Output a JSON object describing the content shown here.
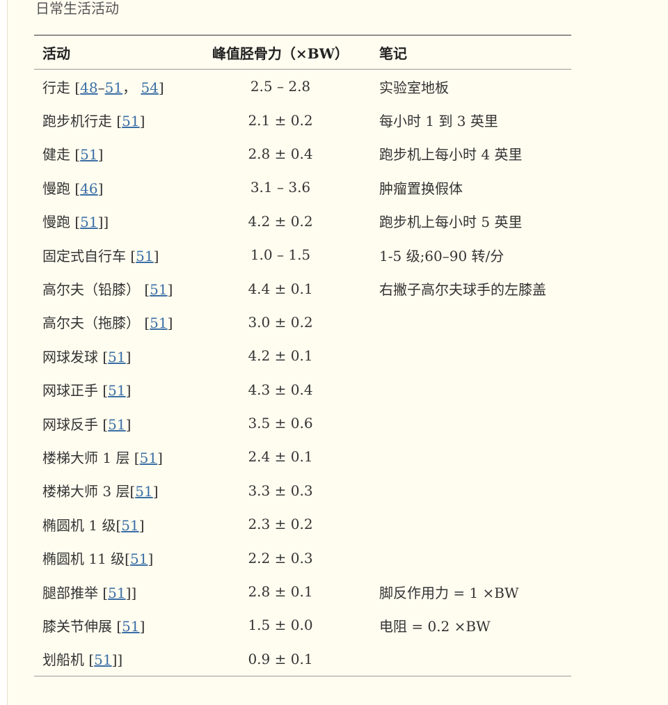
{
  "caption": "日常生活活动",
  "headers": {
    "activity": "活动",
    "force": "峰值胫骨力（×BW）",
    "notes": "笔记"
  },
  "rows": [
    {
      "activity": "行走 ",
      "refs": [
        {
          "pre": "[",
          "ref": "48",
          "post": ""
        },
        {
          "pre": "–",
          "ref": "51",
          "post": "，"
        },
        {
          "pre": " ",
          "ref": "54",
          "post": "]"
        }
      ],
      "force": "2.5 – 2.8",
      "note": "实验室地板"
    },
    {
      "activity": "跑步机行走 ",
      "refs": [
        {
          "pre": "[",
          "ref": "51",
          "post": "]"
        }
      ],
      "force": "2.1 ± 0.2",
      "note": "每小时 1 到 3 英里"
    },
    {
      "activity": "健走 ",
      "refs": [
        {
          "pre": "[",
          "ref": "51",
          "post": "]"
        }
      ],
      "force": "2.8 ± 0.4",
      "note": "跑步机上每小时 4 英里"
    },
    {
      "activity": "慢跑 ",
      "refs": [
        {
          "pre": "[",
          "ref": "46",
          "post": "]"
        }
      ],
      "force": "3.1 – 3.6",
      "note": "肿瘤置换假体"
    },
    {
      "activity": "慢跑 ",
      "refs": [
        {
          "pre": "[",
          "ref": "51",
          "post": "]]"
        }
      ],
      "force": "4.2 ± 0.2",
      "note": "跑步机上每小时 5 英里"
    },
    {
      "activity": "固定式自行车 ",
      "refs": [
        {
          "pre": "[",
          "ref": "51",
          "post": "]"
        }
      ],
      "force": "1.0 – 1.5",
      "note": "1-5 级;60–90 转/分"
    },
    {
      "activity": "高尔夫（铅膝） ",
      "refs": [
        {
          "pre": "[",
          "ref": "51",
          "post": "]"
        }
      ],
      "force": "4.4 ± 0.1",
      "note": "右撇子高尔夫球手的左膝盖"
    },
    {
      "activity": "高尔夫（拖膝） ",
      "refs": [
        {
          "pre": "[",
          "ref": "51",
          "post": "]"
        }
      ],
      "force": "3.0 ± 0.2",
      "note": ""
    },
    {
      "activity": "网球发球 ",
      "refs": [
        {
          "pre": "[",
          "ref": "51",
          "post": "]"
        }
      ],
      "force": "4.2 ± 0.1",
      "note": ""
    },
    {
      "activity": "网球正手 ",
      "refs": [
        {
          "pre": "[",
          "ref": "51",
          "post": "]"
        }
      ],
      "force": "4.3 ± 0.4",
      "note": ""
    },
    {
      "activity": "网球反手 ",
      "refs": [
        {
          "pre": "[",
          "ref": "51",
          "post": "]"
        }
      ],
      "force": "3.5 ± 0.6",
      "note": ""
    },
    {
      "activity": "楼梯大师 1 层 ",
      "refs": [
        {
          "pre": "[",
          "ref": "51",
          "post": "]"
        }
      ],
      "force": "2.4 ± 0.1",
      "note": ""
    },
    {
      "activity": "楼梯大师 3 层",
      "refs": [
        {
          "pre": "[",
          "ref": "51",
          "post": "]"
        }
      ],
      "force": "3.3 ± 0.3",
      "note": ""
    },
    {
      "activity": "椭圆机 1 级",
      "refs": [
        {
          "pre": "[",
          "ref": "51",
          "post": "]"
        }
      ],
      "force": "2.3 ± 0.2",
      "note": ""
    },
    {
      "activity": "椭圆机 11 级",
      "refs": [
        {
          "pre": "[",
          "ref": "51",
          "post": "]"
        }
      ],
      "force": "2.2 ± 0.3",
      "note": ""
    },
    {
      "activity": "腿部推举 ",
      "refs": [
        {
          "pre": "[",
          "ref": "51",
          "post": "]]"
        }
      ],
      "force": "2.8 ± 0.1",
      "note": "脚反作用力 = 1 ×BW"
    },
    {
      "activity": "膝关节伸展 ",
      "refs": [
        {
          "pre": "[",
          "ref": "51",
          "post": "]"
        }
      ],
      "force": "1.5 ± 0.0",
      "note": "电阻 = 0.2 ×BW"
    },
    {
      "activity": "划船机 ",
      "refs": [
        {
          "pre": "[",
          "ref": "51",
          "post": "]]"
        }
      ],
      "force": "0.9 ± 0.1",
      "note": ""
    }
  ]
}
